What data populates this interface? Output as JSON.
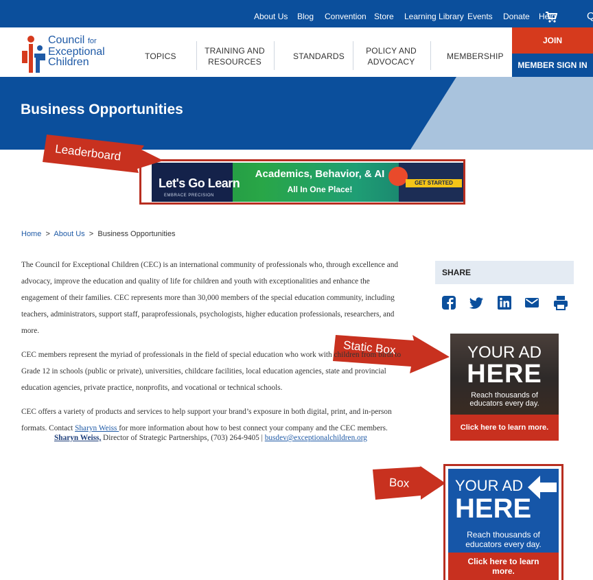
{
  "utility_nav": {
    "items": [
      "About Us",
      "Blog",
      "Convention",
      "Store",
      "Learning Library",
      "Events",
      "Donate",
      "Help"
    ],
    "cart_icon": "cart-icon",
    "search_glyph": "Q"
  },
  "logo": {
    "line1": "Council",
    "line1_small": "for",
    "line2": "Exceptional",
    "line3": "Children"
  },
  "main_nav": {
    "topics": "TOPICS",
    "training_line1": "TRAINING AND",
    "training_line2": "RESOURCES",
    "standards": "STANDARDS",
    "policy_line1": "POLICY AND",
    "policy_line2": "ADVOCACY",
    "membership": "MEMBERSHIP",
    "join": "JOIN",
    "member_sign_in": "MEMBER SIGN IN"
  },
  "hero": {
    "title": "Business Opportunities"
  },
  "callouts": {
    "leaderboard": "Leaderboard",
    "static_box": "Static Box",
    "box": "Box"
  },
  "leaderboard_ad": {
    "logo_text": "Let's Go Learn",
    "tagline": "EMBRACE PRECISION",
    "headline": "Academics, Behavior, & AI",
    "subline": "All In One Place!",
    "cta": "GET STARTED"
  },
  "breadcrumb": {
    "home": "Home",
    "sep": ">",
    "about": "About Us",
    "current": "Business Opportunities"
  },
  "content": {
    "p1": "The Council for Exceptional Children (CEC) is an international community of professionals who, through excellence and advocacy, improve the education and quality of life for children and youth with exceptionalities and enhance the engagement of their families. CEC represents more than 30,000 members of the special education community, including teachers, administrators, support staff, paraprofessionals, psychologists, higher education professionals, researchers, and more.",
    "p2": "CEC members represent the myriad of professionals in the field of special education who work with children from birth to Grade 12  in schools (public or private), universities, childcare facilities, local education agencies, state and provincial education agencies, private practice, nonprofits, and vocational or technical schools.",
    "p3_before": "CEC offers a variety of products and services to help support your brand’s exposure in both digital, print, and in-person formats. Contact ",
    "p3_link": "Sharyn Weiss ",
    "p3_after": "for more information about how to best connect your company and the CEC members.",
    "contact_name": "Sharyn Weiss,",
    "contact_role": " Director of Strategic Partnerships, (703) 264-9405 | ",
    "contact_email": "busdev@exceptionalchildren.org"
  },
  "share": {
    "title": "SHARE",
    "icons": [
      "facebook-icon",
      "twitter-icon",
      "linkedin-icon",
      "email-icon",
      "print-icon"
    ]
  },
  "static_ad": {
    "your_ad": "YOUR AD",
    "here": "HERE",
    "reach_line1": "Reach thousands of",
    "reach_line2": "educators every day.",
    "cta": "Click here to learn more."
  },
  "box_ad": {
    "your_ad": "YOUR AD",
    "here": "HERE",
    "reach_line1": "Reach thousands of",
    "reach_line2": "educators every day.",
    "cta_line1": "Click here to learn",
    "cta_line2": "more."
  },
  "colors": {
    "brand_blue": "#0b4f9c",
    "accent_red": "#d63a1d",
    "share_bg": "#e4ebf3"
  }
}
